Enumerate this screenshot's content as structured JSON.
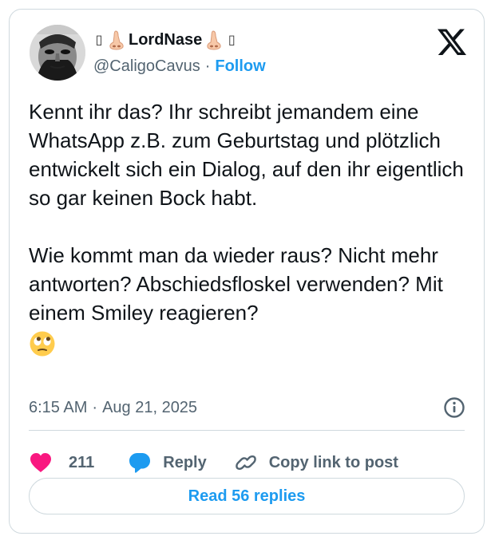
{
  "author": {
    "display_name": "LordNase",
    "name_prefix_glyph": "▯",
    "name_suffix_glyph": "▯",
    "nose_emoji": "nose-emoji",
    "handle": "@CaligoCavus",
    "separator": "·",
    "follow_label": "Follow"
  },
  "platform": {
    "logo_icon": "x-logo-icon"
  },
  "tweet": {
    "paragraph1": "Kennt ihr das? Ihr schreibt jemandem eine WhatsApp z.B. zum Geburtstag und plötzlich entwickelt sich ein Dialog, auf den ihr eigentlich so gar keinen Bock habt.",
    "paragraph2": "Wie kommt man da wieder raus? Nicht mehr antworten? Abschiedsfloskel verwenden? Mit einem Smiley reagieren?",
    "trailing_emoji": "face-with-rolling-eyes-emoji"
  },
  "meta": {
    "time": "6:15 AM",
    "separator": "·",
    "date": "Aug 21, 2025",
    "info_icon": "info-icon"
  },
  "actions": {
    "like_icon": "heart-icon",
    "like_color": "#f91880",
    "like_count": "211",
    "reply_icon": "speech-bubble-icon",
    "reply_color": "#1d9bf0",
    "reply_label": "Reply",
    "copy_icon": "link-icon",
    "copy_label": "Copy link to post"
  },
  "footer": {
    "read_replies_label": "Read 56 replies"
  },
  "colors": {
    "accent": "#1d9bf0",
    "text_primary": "#0f1419",
    "text_secondary": "#536471",
    "border": "#cfd9de"
  }
}
